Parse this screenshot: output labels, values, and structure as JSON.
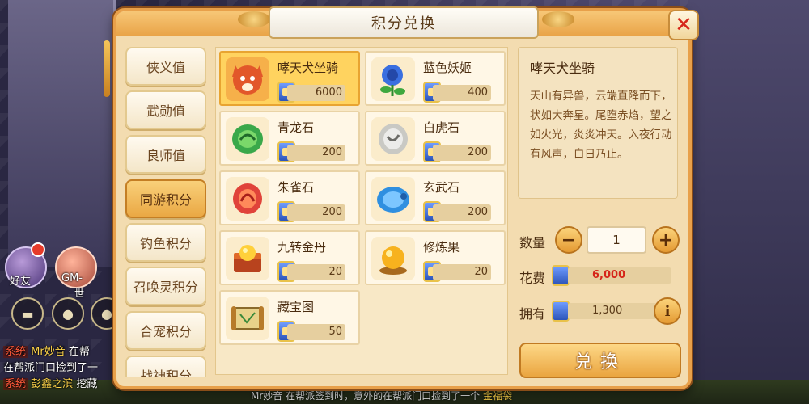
{
  "window": {
    "title": "积分兑换"
  },
  "sidebar": {
    "tabs": [
      {
        "label": "侠义值"
      },
      {
        "label": "武勋值"
      },
      {
        "label": "良师值"
      },
      {
        "label": "同游积分",
        "active": true
      },
      {
        "label": "钓鱼积分"
      },
      {
        "label": "召唤灵积分"
      },
      {
        "label": "合宠积分"
      },
      {
        "label": "战神积分"
      }
    ]
  },
  "items": [
    {
      "name": "哮天犬坐骑",
      "price": "6000",
      "icon": "dog-mount-icon",
      "selected": true
    },
    {
      "name": "蓝色妖姬",
      "price": "400",
      "icon": "blue-rose-icon"
    },
    {
      "name": "青龙石",
      "price": "200",
      "icon": "dragon-stone-icon"
    },
    {
      "name": "白虎石",
      "price": "200",
      "icon": "tiger-stone-icon"
    },
    {
      "name": "朱雀石",
      "price": "200",
      "icon": "phoenix-stone-icon"
    },
    {
      "name": "玄武石",
      "price": "200",
      "icon": "tortoise-stone-icon"
    },
    {
      "name": "九转金丹",
      "price": "20",
      "icon": "golden-pill-icon"
    },
    {
      "name": "修炼果",
      "price": "20",
      "icon": "fruit-icon"
    },
    {
      "name": "藏宝图",
      "price": "50",
      "icon": "treasure-map-icon"
    }
  ],
  "detail": {
    "title": "哮天犬坐骑",
    "description": "天山有异兽，云端直降而下，状如大奔星。尾堕赤焰，望之如火光，炎炎冲天。入夜行动有风声，白日乃止。"
  },
  "purchase": {
    "quantity_label": "数量",
    "quantity": "1",
    "cost_label": "花费",
    "cost": "6,000",
    "own_label": "拥有",
    "own": "1,300",
    "exchange_label": "兑换",
    "minus": "−",
    "plus": "+",
    "info": "i"
  },
  "hud": {
    "friends_label": "好友",
    "gm_label": "GM-",
    "gm_sub": "世"
  },
  "chat": [
    {
      "tag": "系统",
      "name": "Mr妙音",
      "text": "在帮"
    },
    {
      "tag": "",
      "name": "",
      "text": "在帮派门口捡到了一"
    },
    {
      "tag": "系统",
      "name": "彭鑫之滨",
      "text": "挖藏"
    }
  ],
  "ticker": {
    "name": "Mr妙音",
    "text": "在帮派签到时，意外的在帮派门口捡到了一个",
    "item": "金福袋"
  },
  "colors": {
    "accent": "#e8a04a",
    "selected": "#ffd35f",
    "cost": "#d6261a"
  }
}
